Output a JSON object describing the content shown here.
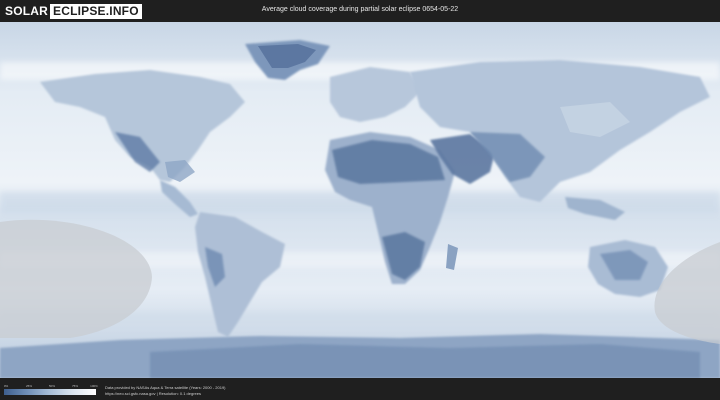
{
  "header": {
    "logo_left": "SOLAR",
    "logo_right": "ECLIPSE.INFO",
    "title": "Average cloud coverage during partial solar eclipse 0654-05-22"
  },
  "legend": {
    "ticks": [
      "0%",
      "25%",
      "50%",
      "75%",
      "100%"
    ],
    "colors": [
      "#3e5f8e",
      "#6f8fb8",
      "#a9bfd8",
      "#dce6f0",
      "#ffffff"
    ]
  },
  "credits": {
    "line1": "Data provided by NASAs Aqua & Terra satellite (Years: 2000 - 2019)",
    "line2": "https://neo.sci.gsfc.nasa.gov | Resolution: 0.1 degrees"
  },
  "map": {
    "ocean_color": "#dfe8f2",
    "land_dark_color": "#5d7aa3",
    "night_shade_color": "#c9ccd0"
  }
}
